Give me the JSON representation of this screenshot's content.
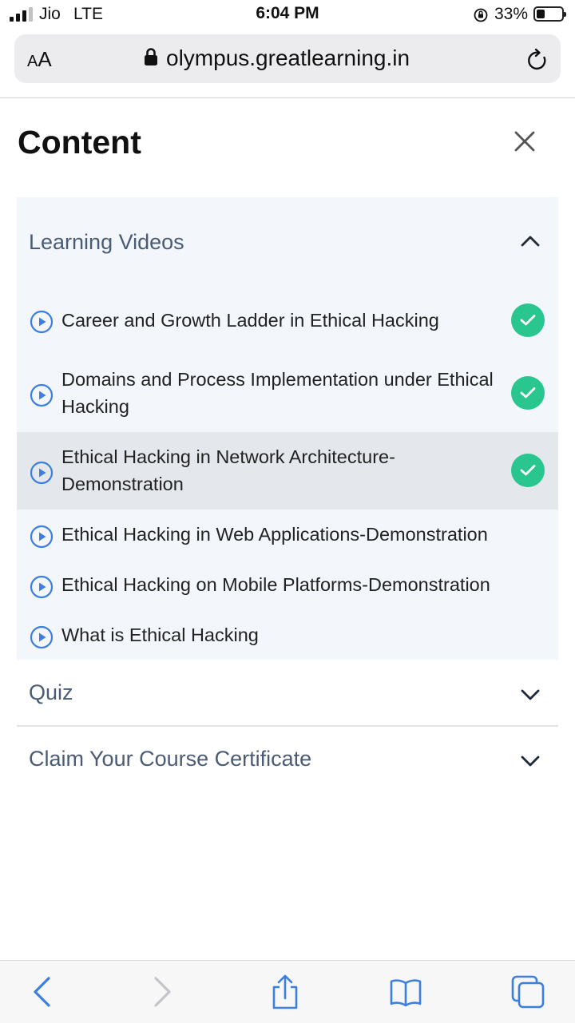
{
  "status": {
    "carrier": "Jio",
    "network": "LTE",
    "time": "6:04 PM",
    "battery": "33%",
    "battery_level": 0.33
  },
  "browser": {
    "text_size_label": "AA",
    "url": "olympus.greatlearning.in"
  },
  "page": {
    "title": "Content"
  },
  "sections": {
    "videos": {
      "title": "Learning Videos",
      "expanded": true,
      "items": [
        {
          "title": "Career and Growth Ladder in Ethical Hacking",
          "completed": true
        },
        {
          "title": "Domains and Process Implementation under Ethical Hacking",
          "completed": true
        },
        {
          "title": "Ethical Hacking in Network Architecture-Demonstration",
          "completed": true,
          "selected": true
        },
        {
          "title": "Ethical Hacking in Web Applications-Demonstration",
          "completed": false
        },
        {
          "title": "Ethical Hacking on Mobile Platforms-Demonstration",
          "completed": false
        },
        {
          "title": "What is Ethical Hacking",
          "completed": false
        }
      ]
    },
    "quiz": {
      "title": "Quiz",
      "expanded": false
    },
    "certificate": {
      "title": "Claim Your Course Certificate",
      "expanded": false
    }
  },
  "colors": {
    "section_title": "#4a5c75",
    "panel_bg": "#f3f7fc",
    "selected_row": "#e4e8ed",
    "complete_badge": "#29c690",
    "play_icon": "#3d7ee0",
    "browser_tint": "#3b7fe0"
  },
  "icons": {
    "close": "close-icon",
    "expand": "chevron-up-icon",
    "collapse": "chevron-down-icon",
    "play": "play-circle-icon",
    "done": "checkmark-icon",
    "toolbar": [
      "back-icon",
      "forward-icon",
      "share-icon",
      "bookmarks-icon",
      "tabs-icon"
    ]
  }
}
